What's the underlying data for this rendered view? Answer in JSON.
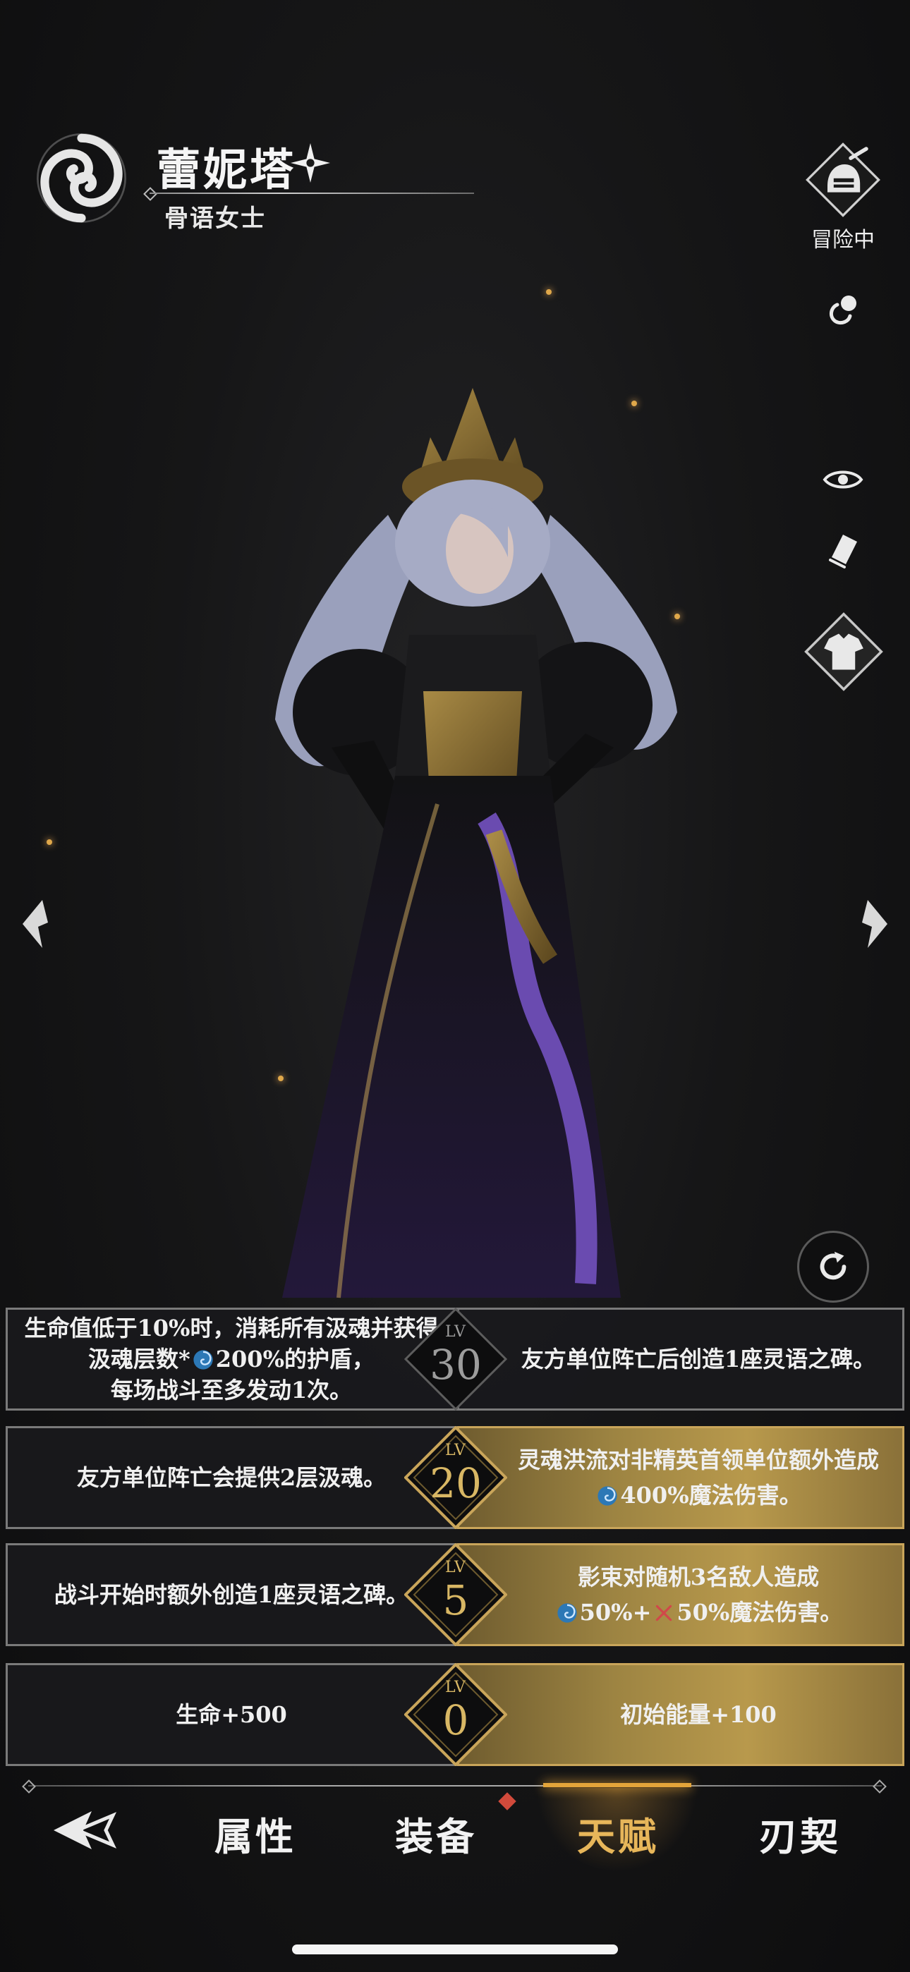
{
  "character": {
    "name": "蕾妮塔",
    "title": "骨语女士"
  },
  "status": {
    "adventure_label": "冒险中"
  },
  "talents": [
    {
      "level_tag": "LV",
      "level": "30",
      "left_text": "生命值低于10%时，消耗所有汲魂并获得汲魂层数*",
      "left_value": "200%的护盾，",
      "left_text_2": "每场战斗至多发动1次。",
      "right_text": "友方单位阵亡后创造1座灵语之碑。",
      "unlocked": false
    },
    {
      "level_tag": "LV",
      "level": "20",
      "left_text": "友方单位阵亡会提供2层汲魂。",
      "right_text": "灵魂洪流对非精英首领单位额外造成",
      "right_value": "400%魔法伤害。",
      "unlocked": true
    },
    {
      "level_tag": "LV",
      "level": "5",
      "left_text": "战斗开始时额外创造1座灵语之碑。",
      "right_text": "影束对随机3名敌人造成",
      "right_value_a": "50%+",
      "right_value_b": "50%魔法伤害。",
      "unlocked": true
    },
    {
      "level_tag": "LV",
      "level": "0",
      "left_text": "生命+500",
      "right_text": "初始能量+100",
      "unlocked": true
    }
  ],
  "nav": {
    "items": [
      "属性",
      "装备",
      "天赋",
      "刃契"
    ],
    "active": "天赋"
  },
  "colors": {
    "gold_accent": "#d8b764",
    "active_tab": "#e7b65a",
    "notify": "#d14a3b"
  }
}
